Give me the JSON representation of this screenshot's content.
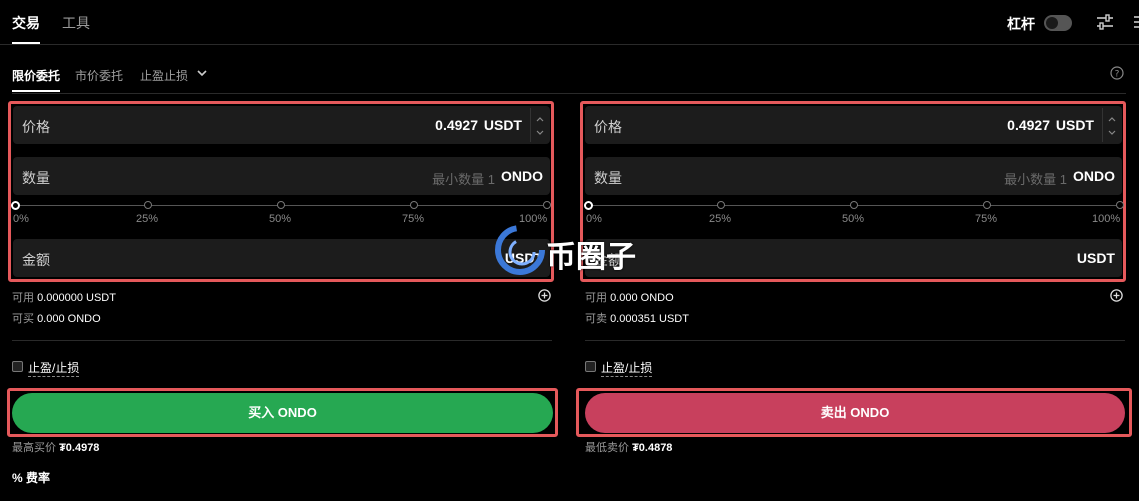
{
  "header": {
    "tabs": [
      {
        "label": "交易",
        "active": true
      },
      {
        "label": "工具",
        "active": false
      }
    ],
    "leverage_label": "杠杆",
    "leverage_on": false
  },
  "order_types": {
    "tabs": [
      {
        "label": "限价委托",
        "active": true
      },
      {
        "label": "市价委托",
        "active": false
      },
      {
        "label": "止盈止损",
        "active": false
      }
    ]
  },
  "buy": {
    "price_label": "价格",
    "price_value": "0.4927",
    "price_unit": "USDT",
    "qty_label": "数量",
    "qty_placeholder": "最小数量 1",
    "qty_unit": "ONDO",
    "slider_ticks": [
      "0%",
      "25%",
      "50%",
      "75%",
      "100%"
    ],
    "slider_value_pct": 0,
    "amount_label": "金额",
    "amount_unit": "USDT",
    "available_label": "可用",
    "available_value": "0.000000 USDT",
    "can_trade_label": "可买",
    "can_trade_value": "0.000 ONDO",
    "tpsl_label": "止盈/止损",
    "button_label": "买入 ONDO",
    "best_price_label": "最高买价",
    "best_price_value": "₮0.4978"
  },
  "sell": {
    "price_label": "价格",
    "price_value": "0.4927",
    "price_unit": "USDT",
    "qty_label": "数量",
    "qty_placeholder": "最小数量 1",
    "qty_unit": "ONDO",
    "slider_ticks": [
      "0%",
      "25%",
      "50%",
      "75%",
      "100%"
    ],
    "slider_value_pct": 0,
    "amount_label": "金额",
    "amount_unit": "USDT",
    "available_label": "可用",
    "available_value": "0.000 ONDO",
    "can_trade_label": "可卖",
    "can_trade_value": "0.000351 USDT",
    "tpsl_label": "止盈/止损",
    "button_label": "卖出 ONDO",
    "best_price_label": "最低卖价",
    "best_price_value": "₮0.4878"
  },
  "fee_label": "费率",
  "watermark_text": "币圈子",
  "colors": {
    "buy": "#26a852",
    "sell": "#c8405d",
    "highlight": "#e5595b",
    "background": "#000000"
  }
}
